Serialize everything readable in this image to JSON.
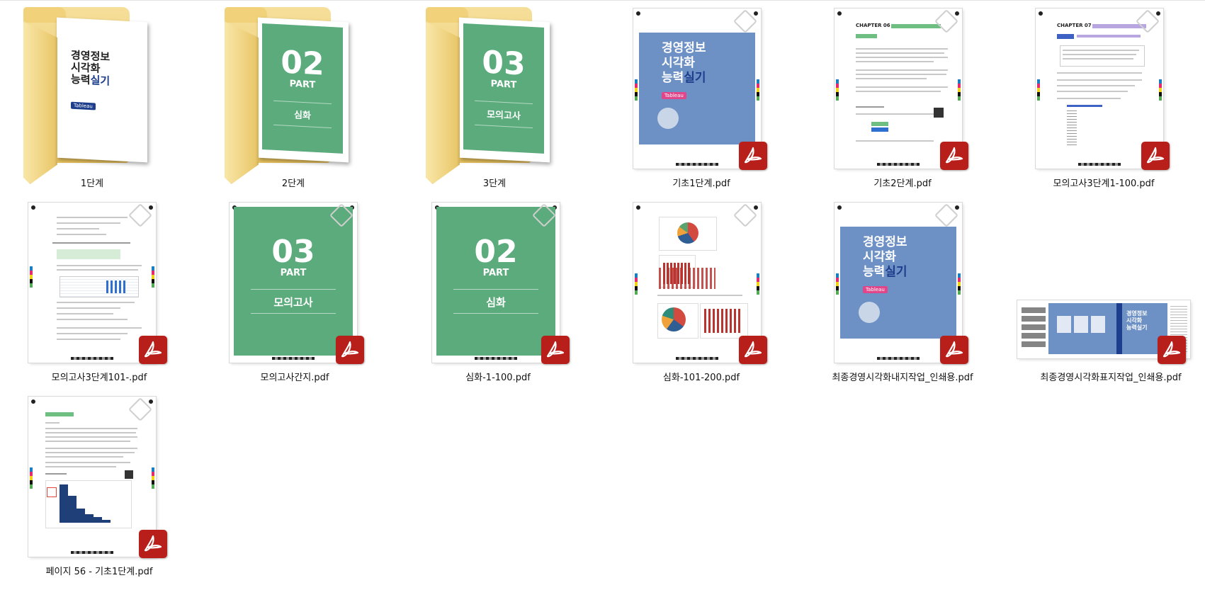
{
  "items": [
    {
      "name": "1단계"
    },
    {
      "name": "2단계"
    },
    {
      "name": "3단계"
    },
    {
      "name": "기초1단계.pdf"
    },
    {
      "name": "기초2단계.pdf"
    },
    {
      "name": "모의고사3단계1-100.pdf"
    },
    {
      "name": "모의고사3단계101-.pdf"
    },
    {
      "name": "모의고사간지.pdf"
    },
    {
      "name": "심화-1-100.pdf"
    },
    {
      "name": "심화-101-200.pdf"
    },
    {
      "name": "최종경영시각화내지작업_인쇄용.pdf"
    },
    {
      "name": "최종경영시각화표지작업_인쇄용.pdf"
    },
    {
      "name": "페이지 56 - 기초1단계.pdf"
    }
  ],
  "covers": {
    "title_line1": "경영정보",
    "title_line2": "시각화",
    "title_line3a": "능력",
    "title_line3b": "실기",
    "tag": "Tableau",
    "part02_num": "02",
    "part03_num": "03",
    "part_word": "PART",
    "sec_deep": "심화",
    "sec_mock": "모의고사",
    "chapter6": "CHAPTER 06",
    "chapter7": "CHAPTER 07"
  },
  "colors": {
    "pdf_badge": "#b81f1a",
    "cover_blue": "#6d90c5",
    "cover_green": "#5bab7c",
    "folder": "#f1d27b"
  }
}
